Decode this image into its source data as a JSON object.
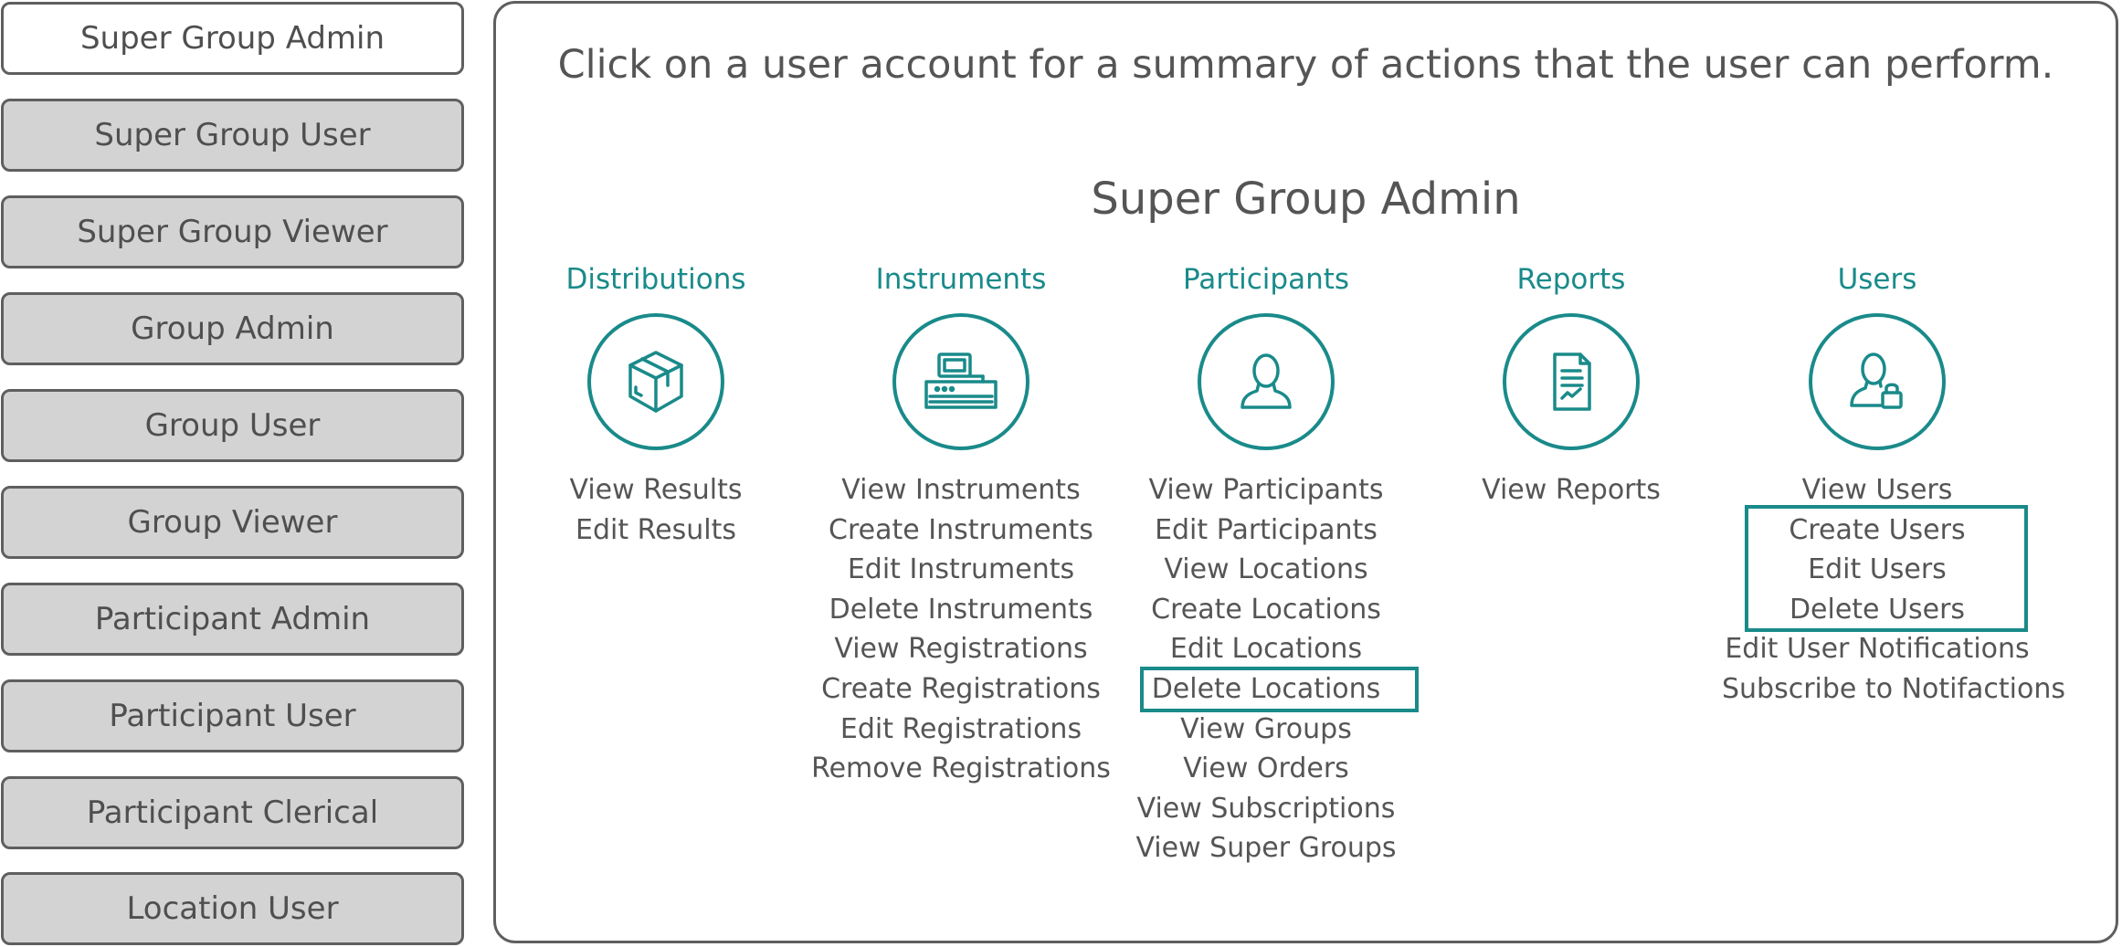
{
  "sidebar": {
    "roles": [
      {
        "label": "Super Group Admin",
        "active": true
      },
      {
        "label": "Super Group User",
        "active": false
      },
      {
        "label": "Super Group Viewer",
        "active": false
      },
      {
        "label": "Group Admin",
        "active": false
      },
      {
        "label": "Group User",
        "active": false
      },
      {
        "label": "Group Viewer",
        "active": false
      },
      {
        "label": "Participant Admin",
        "active": false
      },
      {
        "label": "Participant User",
        "active": false
      },
      {
        "label": "Participant Clerical",
        "active": false
      },
      {
        "label": "Location User",
        "active": false
      }
    ]
  },
  "main": {
    "instruction": "Click on a user account for a summary of actions that the user can perform.",
    "role_title": "Super Group Admin",
    "accent_color": "#1a8a8a",
    "categories": [
      {
        "title": "Distributions",
        "icon": "package-box-icon",
        "actions": [
          "View Results",
          "Edit Results"
        ]
      },
      {
        "title": "Instruments",
        "icon": "instrument-device-icon",
        "actions": [
          "View Instruments",
          "Create Instruments",
          "Edit Instruments",
          "Delete Instruments",
          "View Registrations",
          "Create Registrations",
          "Edit Registrations",
          "Remove Registrations"
        ]
      },
      {
        "title": "Participants",
        "icon": "person-icon",
        "actions": [
          "View Participants",
          "Edit Participants",
          "View Locations",
          "Create Locations",
          "Edit Locations",
          "Delete Locations",
          "View Groups",
          "View Orders",
          "View Subscriptions",
          "View Super Groups"
        ]
      },
      {
        "title": "Reports",
        "icon": "report-document-icon",
        "actions": [
          "View Reports"
        ]
      },
      {
        "title": "Users",
        "icon": "user-lock-icon",
        "actions": [
          "View Users",
          "Create Users",
          "Edit Users",
          "Delete Users",
          "Edit User Notifications",
          "Subscribe to Notifactions"
        ]
      }
    ]
  }
}
